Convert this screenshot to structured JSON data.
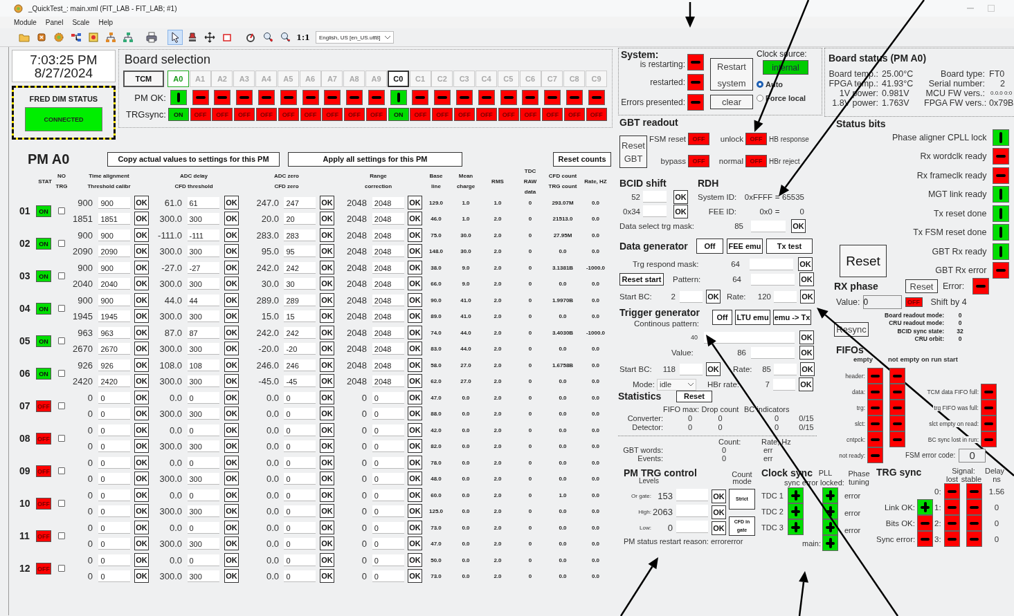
{
  "window": {
    "title": "_QuickTest_: main.xml (FIT_LAB - FIT_LAB; #1)"
  },
  "menu": [
    "Module",
    "Panel",
    "Scale",
    "Help"
  ],
  "toolbar": {
    "tools": [
      {
        "selected": false
      },
      {
        "selected": false
      },
      {
        "selected": false
      },
      {
        "selected": false
      },
      {
        "selected": false
      },
      {
        "selected": false
      },
      {
        "selected": false
      },
      {
        "selected": false
      },
      {
        "selected": true
      },
      {
        "selected": false
      },
      {
        "selected": false
      },
      {
        "selected": false
      },
      {
        "selected": false
      },
      {
        "selected": false
      },
      {
        "selected": false
      }
    ],
    "zoom_reset": "1:1",
    "language": "English, US [en_US.utf8]"
  },
  "clock": {
    "time": "7:03:25 PM",
    "date": "8/27/2024"
  },
  "fred": {
    "title": "FRED DIM STATUS",
    "status": "CONNECTED",
    "connected": true
  },
  "board_selection": {
    "title": "Board selection",
    "tcm": "TCM",
    "pm_ok_label": "PM OK:",
    "trgsync_label": "TRGsync:",
    "boards": [
      {
        "label": "A0",
        "selected": true,
        "disabled": false,
        "pm_ok": true,
        "trgsync": "ON",
        "trgsync_on": true
      },
      {
        "label": "A1",
        "selected": false,
        "disabled": true,
        "pm_ok": false,
        "trgsync": "OFF",
        "trgsync_on": false
      },
      {
        "label": "A2",
        "selected": false,
        "disabled": true,
        "pm_ok": false,
        "trgsync": "OFF",
        "trgsync_on": false
      },
      {
        "label": "A3",
        "selected": false,
        "disabled": true,
        "pm_ok": false,
        "trgsync": "OFF",
        "trgsync_on": false
      },
      {
        "label": "A4",
        "selected": false,
        "disabled": true,
        "pm_ok": false,
        "trgsync": "OFF",
        "trgsync_on": false
      },
      {
        "label": "A5",
        "selected": false,
        "disabled": true,
        "pm_ok": false,
        "trgsync": "OFF",
        "trgsync_on": false
      },
      {
        "label": "A6",
        "selected": false,
        "disabled": true,
        "pm_ok": false,
        "trgsync": "OFF",
        "trgsync_on": false
      },
      {
        "label": "A7",
        "selected": false,
        "disabled": true,
        "pm_ok": false,
        "trgsync": "OFF",
        "trgsync_on": false
      },
      {
        "label": "A8",
        "selected": false,
        "disabled": true,
        "pm_ok": false,
        "trgsync": "OFF",
        "trgsync_on": false
      },
      {
        "label": "A9",
        "selected": false,
        "disabled": true,
        "pm_ok": false,
        "trgsync": "OFF",
        "trgsync_on": false
      },
      {
        "label": "C0",
        "selected": false,
        "disabled": false,
        "pm_ok": true,
        "trgsync": "ON",
        "trgsync_on": true
      },
      {
        "label": "C1",
        "selected": false,
        "disabled": true,
        "pm_ok": false,
        "trgsync": "OFF",
        "trgsync_on": false
      },
      {
        "label": "C2",
        "selected": false,
        "disabled": true,
        "pm_ok": false,
        "trgsync": "OFF",
        "trgsync_on": false
      },
      {
        "label": "C3",
        "selected": false,
        "disabled": true,
        "pm_ok": false,
        "trgsync": "OFF",
        "trgsync_on": false
      },
      {
        "label": "C4",
        "selected": false,
        "disabled": true,
        "pm_ok": false,
        "trgsync": "OFF",
        "trgsync_on": false
      },
      {
        "label": "C5",
        "selected": false,
        "disabled": true,
        "pm_ok": false,
        "trgsync": "OFF",
        "trgsync_on": false
      },
      {
        "label": "C6",
        "selected": false,
        "disabled": true,
        "pm_ok": false,
        "trgsync": "OFF",
        "trgsync_on": false
      },
      {
        "label": "C7",
        "selected": false,
        "disabled": true,
        "pm_ok": false,
        "trgsync": "OFF",
        "trgsync_on": false
      },
      {
        "label": "C8",
        "selected": false,
        "disabled": true,
        "pm_ok": false,
        "trgsync": "OFF",
        "trgsync_on": false
      },
      {
        "label": "C9",
        "selected": false,
        "disabled": true,
        "pm_ok": false,
        "trgsync": "OFF",
        "trgsync_on": false
      }
    ]
  },
  "pm": {
    "title": "PM A0",
    "buttons": [
      "Copy actual values to settings for this PM",
      "Apply all settings for this PM",
      "Reset counts"
    ],
    "headers": [
      [
        "STAT"
      ],
      [
        "NO",
        "TRG"
      ],
      [
        "Time  alignment",
        "Threshold calibr"
      ],
      [
        "ADC delay",
        "CFD threshold"
      ],
      [
        "ADC zero",
        "CFD zero"
      ],
      [
        "Range",
        "correction"
      ],
      [
        "Base",
        "line"
      ],
      [
        "Mean",
        "charge"
      ],
      [
        "RMS"
      ],
      [
        "TDC",
        "RAW",
        "data"
      ],
      [
        "CFD count",
        "TRG count"
      ],
      [
        "Rate, HZ"
      ]
    ],
    "channels": [
      {
        "num": "01",
        "stat": "ON",
        "on": true,
        "no_trg": false,
        "settings": [
          [
            [
              "900",
              "900",
              "OK"
            ],
            [
              "1851",
              "1851",
              "OK"
            ]
          ],
          [
            [
              "61.0",
              "61",
              "OK"
            ],
            [
              "300.0",
              "300",
              "OK"
            ]
          ],
          [
            [
              "247.0",
              "247",
              "OK"
            ],
            [
              "20.0",
              "20",
              "OK"
            ]
          ],
          [
            [
              "2048",
              "2048",
              "OK"
            ],
            [
              "2048",
              "2048",
              "OK"
            ]
          ]
        ],
        "readings": [
          [
            "129.0",
            "46.0"
          ],
          [
            "1.0",
            "1.0"
          ],
          [
            "1.0",
            "2.0"
          ],
          [
            "0",
            "0"
          ],
          [
            "293.07M",
            "21513.0"
          ],
          [
            "0.0",
            "0.0"
          ]
        ]
      },
      {
        "num": "02",
        "stat": "ON",
        "on": true,
        "no_trg": false,
        "settings": [
          [
            [
              "900",
              "900",
              "OK"
            ],
            [
              "2090",
              "2090",
              "OK"
            ]
          ],
          [
            [
              "-111.0",
              "-111",
              "OK"
            ],
            [
              "300.0",
              "300",
              "OK"
            ]
          ],
          [
            [
              "283.0",
              "283",
              "OK"
            ],
            [
              "95.0",
              "95",
              "OK"
            ]
          ],
          [
            [
              "2048",
              "2048",
              "OK"
            ],
            [
              "2048",
              "2048",
              "OK"
            ]
          ]
        ],
        "readings": [
          [
            "75.0",
            "148.0"
          ],
          [
            "30.0",
            "30.0"
          ],
          [
            "2.0",
            "2.0"
          ],
          [
            "0",
            "0"
          ],
          [
            "27.95M",
            "0.0"
          ],
          [
            "0.0",
            "0.0"
          ]
        ]
      },
      {
        "num": "03",
        "stat": "ON",
        "on": true,
        "no_trg": false,
        "settings": [
          [
            [
              "900",
              "900",
              "OK"
            ],
            [
              "2040",
              "2040",
              "OK"
            ]
          ],
          [
            [
              "-27.0",
              "-27",
              "OK"
            ],
            [
              "300.0",
              "300",
              "OK"
            ]
          ],
          [
            [
              "242.0",
              "242",
              "OK"
            ],
            [
              "30.0",
              "30",
              "OK"
            ]
          ],
          [
            [
              "2048",
              "2048",
              "OK"
            ],
            [
              "2048",
              "2048",
              "OK"
            ]
          ]
        ],
        "readings": [
          [
            "38.0",
            "66.0"
          ],
          [
            "9.0",
            "9.0"
          ],
          [
            "2.0",
            "2.0"
          ],
          [
            "0",
            "0"
          ],
          [
            "3.1381B",
            "0.0"
          ],
          [
            "-1000.0",
            "0.0"
          ]
        ]
      },
      {
        "num": "04",
        "stat": "ON",
        "on": true,
        "no_trg": false,
        "settings": [
          [
            [
              "900",
              "900",
              "OK"
            ],
            [
              "1945",
              "1945",
              "OK"
            ]
          ],
          [
            [
              "44.0",
              "44",
              "OK"
            ],
            [
              "300.0",
              "300",
              "OK"
            ]
          ],
          [
            [
              "289.0",
              "289",
              "OK"
            ],
            [
              "15.0",
              "15",
              "OK"
            ]
          ],
          [
            [
              "2048",
              "2048",
              "OK"
            ],
            [
              "2048",
              "2048",
              "OK"
            ]
          ]
        ],
        "readings": [
          [
            "90.0",
            "89.0"
          ],
          [
            "41.0",
            "41.0"
          ],
          [
            "2.0",
            "2.0"
          ],
          [
            "0",
            "0"
          ],
          [
            "1.9970B",
            "0.0"
          ],
          [
            "0.0",
            "0.0"
          ]
        ]
      },
      {
        "num": "05",
        "stat": "ON",
        "on": true,
        "no_trg": false,
        "settings": [
          [
            [
              "963",
              "963",
              "OK"
            ],
            [
              "2670",
              "2670",
              "OK"
            ]
          ],
          [
            [
              "87.0",
              "87",
              "OK"
            ],
            [
              "300.0",
              "300",
              "OK"
            ]
          ],
          [
            [
              "242.0",
              "242",
              "OK"
            ],
            [
              "-20.0",
              "-20",
              "OK"
            ]
          ],
          [
            [
              "2048",
              "2048",
              "OK"
            ],
            [
              "2048",
              "2048",
              "OK"
            ]
          ]
        ],
        "readings": [
          [
            "74.0",
            "83.0"
          ],
          [
            "44.0",
            "44.0"
          ],
          [
            "2.0",
            "2.0"
          ],
          [
            "0",
            "0"
          ],
          [
            "3.4030B",
            "0.0"
          ],
          [
            "-1000.0",
            "0.0"
          ]
        ]
      },
      {
        "num": "06",
        "stat": "ON",
        "on": true,
        "no_trg": false,
        "settings": [
          [
            [
              "926",
              "926",
              "OK"
            ],
            [
              "2420",
              "2420",
              "OK"
            ]
          ],
          [
            [
              "108.0",
              "108",
              "OK"
            ],
            [
              "300.0",
              "300",
              "OK"
            ]
          ],
          [
            [
              "246.0",
              "246",
              "OK"
            ],
            [
              "-45.0",
              "-45",
              "OK"
            ]
          ],
          [
            [
              "2048",
              "2048",
              "OK"
            ],
            [
              "2048",
              "2048",
              "OK"
            ]
          ]
        ],
        "readings": [
          [
            "58.0",
            "62.0"
          ],
          [
            "27.0",
            "27.0"
          ],
          [
            "2.0",
            "2.0"
          ],
          [
            "0",
            "0"
          ],
          [
            "1.6758B",
            "0.0"
          ],
          [
            "0.0",
            "0.0"
          ]
        ]
      },
      {
        "num": "07",
        "stat": "OFF",
        "on": false,
        "no_trg": false,
        "settings": [
          [
            [
              "0",
              "0",
              "OK"
            ],
            [
              "0",
              "0",
              "OK"
            ]
          ],
          [
            [
              "0.0",
              "0",
              "OK"
            ],
            [
              "300.0",
              "300",
              "OK"
            ]
          ],
          [
            [
              "0.0",
              "0",
              "OK"
            ],
            [
              "0.0",
              "0",
              "OK"
            ]
          ],
          [
            [
              "0",
              "0",
              "OK"
            ],
            [
              "0",
              "0",
              "OK"
            ]
          ]
        ],
        "readings": [
          [
            "47.0",
            "88.0"
          ],
          [
            "0.0",
            "0.0"
          ],
          [
            "2.0",
            "2.0"
          ],
          [
            "0",
            "0"
          ],
          [
            "0.0",
            "0.0"
          ],
          [
            "0.0",
            "0.0"
          ]
        ]
      },
      {
        "num": "08",
        "stat": "OFF",
        "on": false,
        "no_trg": false,
        "settings": [
          [
            [
              "0",
              "0",
              "OK"
            ],
            [
              "0",
              "0",
              "OK"
            ]
          ],
          [
            [
              "0.0",
              "0",
              "OK"
            ],
            [
              "300.0",
              "300",
              "OK"
            ]
          ],
          [
            [
              "0.0",
              "0",
              "OK"
            ],
            [
              "0.0",
              "0",
              "OK"
            ]
          ],
          [
            [
              "0",
              "0",
              "OK"
            ],
            [
              "0",
              "0",
              "OK"
            ]
          ]
        ],
        "readings": [
          [
            "42.0",
            "82.0"
          ],
          [
            "0.0",
            "0.0"
          ],
          [
            "2.0",
            "2.0"
          ],
          [
            "0",
            "0"
          ],
          [
            "0.0",
            "0.0"
          ],
          [
            "0.0",
            "0.0"
          ]
        ]
      },
      {
        "num": "09",
        "stat": "OFF",
        "on": false,
        "no_trg": false,
        "settings": [
          [
            [
              "0",
              "0",
              "OK"
            ],
            [
              "0",
              "0",
              "OK"
            ]
          ],
          [
            [
              "0.0",
              "0",
              "OK"
            ],
            [
              "300.0",
              "300",
              "OK"
            ]
          ],
          [
            [
              "0.0",
              "0",
              "OK"
            ],
            [
              "0.0",
              "0",
              "OK"
            ]
          ],
          [
            [
              "0",
              "0",
              "OK"
            ],
            [
              "0",
              "0",
              "OK"
            ]
          ]
        ],
        "readings": [
          [
            "78.0",
            "48.0"
          ],
          [
            "0.0",
            "0.0"
          ],
          [
            "2.0",
            "2.0"
          ],
          [
            "0",
            "0"
          ],
          [
            "0.0",
            "0.0"
          ],
          [
            "0.0",
            "0.0"
          ]
        ]
      },
      {
        "num": "10",
        "stat": "OFF",
        "on": false,
        "no_trg": false,
        "settings": [
          [
            [
              "0",
              "0",
              "OK"
            ],
            [
              "0",
              "0",
              "OK"
            ]
          ],
          [
            [
              "0.0",
              "0",
              "OK"
            ],
            [
              "300.0",
              "300",
              "OK"
            ]
          ],
          [
            [
              "0.0",
              "0",
              "OK"
            ],
            [
              "0.0",
              "0",
              "OK"
            ]
          ],
          [
            [
              "0",
              "0",
              "OK"
            ],
            [
              "0",
              "0",
              "OK"
            ]
          ]
        ],
        "readings": [
          [
            "60.0",
            "125.0"
          ],
          [
            "0.0",
            "0.0"
          ],
          [
            "2.0",
            "2.0"
          ],
          [
            "0",
            "0"
          ],
          [
            "1.0",
            "0.0"
          ],
          [
            "0.0",
            "0.0"
          ]
        ]
      },
      {
        "num": "11",
        "stat": "OFF",
        "on": false,
        "no_trg": false,
        "settings": [
          [
            [
              "0",
              "0",
              "OK"
            ],
            [
              "0",
              "0",
              "OK"
            ]
          ],
          [
            [
              "0.0",
              "0",
              "OK"
            ],
            [
              "300.0",
              "300",
              "OK"
            ]
          ],
          [
            [
              "0.0",
              "0",
              "OK"
            ],
            [
              "0.0",
              "0",
              "OK"
            ]
          ],
          [
            [
              "0",
              "0",
              "OK"
            ],
            [
              "0",
              "0",
              "OK"
            ]
          ]
        ],
        "readings": [
          [
            "73.0",
            "47.0"
          ],
          [
            "0.0",
            "0.0"
          ],
          [
            "2.0",
            "2.0"
          ],
          [
            "0",
            "0"
          ],
          [
            "0.0",
            "0.0"
          ],
          [
            "0.0",
            "0.0"
          ]
        ]
      },
      {
        "num": "12",
        "stat": "OFF",
        "on": false,
        "no_trg": false,
        "settings": [
          [
            [
              "0",
              "0",
              "OK"
            ],
            [
              "0",
              "0",
              "OK"
            ]
          ],
          [
            [
              "0.0",
              "0",
              "OK"
            ],
            [
              "300.0",
              "300",
              "OK"
            ]
          ],
          [
            [
              "0.0",
              "0",
              "OK"
            ],
            [
              "0.0",
              "0",
              "OK"
            ]
          ],
          [
            [
              "0",
              "0",
              "OK"
            ],
            [
              "0",
              "0",
              "OK"
            ]
          ]
        ],
        "readings": [
          [
            "50.0",
            "73.0"
          ],
          [
            "0.0",
            "0.0"
          ],
          [
            "2.0",
            "2.0"
          ],
          [
            "0",
            "0"
          ],
          [
            "0.0",
            "0.0"
          ],
          [
            "0.0",
            "0.0"
          ]
        ]
      }
    ]
  },
  "system": {
    "title": "System:",
    "indicators": [
      {
        "label": "is restarting:",
        "on": false
      },
      {
        "label": "restarted:",
        "on": false
      },
      {
        "label": "Errors presented:",
        "on": false
      }
    ],
    "restart_button": "Restart system",
    "clear_button": "clear",
    "clock_source": {
      "label": "Clock source:",
      "value": "internal",
      "ok": true,
      "options": [
        {
          "label": "Auto",
          "selected": true
        },
        {
          "label": "Force local",
          "selected": false
        }
      ]
    }
  },
  "gbt_readout": {
    "title": "GBT readout",
    "reset_button": "Reset GBT",
    "rows": [
      [
        {
          "label": "FSM reset",
          "value": "OFF",
          "on": false
        },
        {
          "label": "unlock",
          "value": "OFF",
          "on": false,
          "note": "HB response"
        }
      ],
      [
        {
          "label": "bypass",
          "value": "OFF",
          "on": false
        },
        {
          "label": "normal",
          "value": "OFF",
          "on": false,
          "note": "HBr reject"
        }
      ]
    ]
  },
  "bcid_shift": {
    "title": "BCID shift",
    "rows": [
      {
        "value": "52",
        "button": "OK"
      },
      {
        "value": "0x34",
        "button": "OK"
      }
    ]
  },
  "rdh": {
    "title": "RDH",
    "rows": [
      {
        "label": "System ID:",
        "hex": "0xFFFF",
        "eq": "=",
        "dec": "65535"
      },
      {
        "label": "FEE ID:",
        "hex": "0x0",
        "eq": "=",
        "dec": "0"
      }
    ],
    "mask": {
      "label": "Data select trg mask:",
      "value": "85",
      "button": "OK"
    }
  },
  "data_generator": {
    "title": "Data generator",
    "modes": [
      "Off",
      "FEE emu",
      "Tx test"
    ],
    "trg_respond": {
      "label": "Trg respond mask:",
      "value": "64",
      "button": "OK"
    },
    "reset_start": "Reset start",
    "pattern": {
      "label": "Pattern:",
      "value": "64",
      "button": "OK"
    },
    "start_bc": {
      "label": "Start BC:",
      "value": "2",
      "button": "OK"
    },
    "rate": {
      "label": "Rate:",
      "value": "120",
      "button": "OK"
    }
  },
  "trigger_generator": {
    "title": "Trigger generator",
    "modes": [
      "Off",
      "LTU emu",
      "emu -> Tx"
    ],
    "pattern_label": "Continous pattern:",
    "pattern": {
      "value": "40",
      "button": "OK"
    },
    "value": {
      "label": "Value:",
      "value": "86",
      "button": "OK"
    },
    "start_bc": {
      "label": "Start BC:",
      "value": "118",
      "button": "OK"
    },
    "rate": {
      "label": "Rate:",
      "value": "85",
      "button": "OK"
    },
    "mode": {
      "label": "Mode:",
      "value": "idle"
    },
    "hbr_rate": {
      "label": "HBr rate:",
      "value": "7",
      "button": "OK"
    }
  },
  "statistics": {
    "title": "Statistics",
    "reset": "Reset",
    "headers": [
      "FIFO max:",
      "Drop count",
      "BC indicators"
    ],
    "rows": [
      {
        "label": "Converter:",
        "values": [
          "0",
          "0",
          "0",
          "0/15"
        ]
      },
      {
        "label": "Detector:",
        "values": [
          "0",
          "0",
          "0",
          "0/15"
        ]
      }
    ],
    "count_headers": [
      "Count:",
      "Rate, Hz"
    ],
    "count_rows": [
      {
        "label": "GBT words:",
        "values": [
          "0",
          "err"
        ]
      },
      {
        "label": "Events:",
        "values": [
          "0",
          "err"
        ]
      }
    ]
  },
  "pm_trg_control": {
    "title": "PM TRG control",
    "levels_label": "Levels",
    "count_mode_label": "Count mode",
    "levels": [
      {
        "label": "Or gate:",
        "value": "153",
        "button": "OK"
      },
      {
        "label": "High:",
        "value": "2063",
        "button": "OK"
      },
      {
        "label": "Low:",
        "value": "0",
        "button": "OK"
      }
    ],
    "mode_buttons": [
      "Strict",
      "CFD in gate"
    ],
    "restart_reason": "PM status restart reason: errorerror"
  },
  "clock_sync": {
    "title": "Clock sync",
    "sync_error_label": "sync error",
    "tdcs": [
      {
        "label": "TDC 1",
        "ok": true
      },
      {
        "label": "TDC 2",
        "ok": true
      },
      {
        "label": "TDC 3",
        "ok": true
      }
    ],
    "pll_label": "PLL",
    "locked_label": "locked:",
    "pll": [
      {
        "ok": true
      },
      {
        "ok": true
      },
      {
        "ok": true
      },
      {
        "label": "main:",
        "ok": true
      }
    ],
    "phase_label": "Phase tuning",
    "phase": [
      "error",
      "error",
      "error"
    ]
  },
  "board_status": {
    "title": "Board status (PM A0)",
    "left": [
      {
        "label": "Board temp.:",
        "value": "25.00°C"
      },
      {
        "label": "FPGA temp.:",
        "value": "41.93°C"
      },
      {
        "label": "1V power:",
        "value": "0.981V"
      },
      {
        "label": "1.8V power:",
        "value": "1.763V"
      }
    ],
    "right": [
      {
        "label": "Board type:",
        "value": "FT0"
      },
      {
        "label": "Serial number:",
        "value": "2"
      },
      {
        "label": "MCU FW vers.:",
        "value": "0.0.0 0:0"
      },
      {
        "label": "FPGA FW vers.:",
        "value": "0x79B"
      }
    ]
  },
  "status_bits": {
    "title": "Status bits",
    "bits": [
      {
        "label": "Phase aligner CPLL lock",
        "ok": true
      },
      {
        "label": "Rx wordclk ready",
        "ok": false
      },
      {
        "label": "Rx frameclk ready",
        "ok": false
      },
      {
        "label": "MGT link ready",
        "ok": true
      },
      {
        "label": "Tx reset done",
        "ok": true
      },
      {
        "label": "Tx FSM reset done",
        "ok": true
      },
      {
        "label": "GBT Rx ready",
        "ok": true
      },
      {
        "label": "GBT Rx error",
        "ok": false
      }
    ],
    "reset_button": "Reset"
  },
  "rx_phase": {
    "title": "RX phase",
    "reset": "Reset",
    "error_label": "Error:",
    "error": false,
    "value_label": "Value:",
    "value": "0",
    "shift": {
      "value": "OFF",
      "on": false,
      "label": "Shift by 4"
    }
  },
  "readout": {
    "rows": [
      {
        "label": "Board readout mode:",
        "value": "0"
      },
      {
        "label": "CRU readout mode:",
        "value": "0"
      },
      {
        "label": "BCID sync state:",
        "value": "32"
      },
      {
        "label": "CRU orbit:",
        "value": "0"
      }
    ],
    "resync": "Resync"
  },
  "fifos": {
    "title": "FIFOs",
    "empty_label": "empty",
    "not_empty_label": "not empty on run start",
    "rows": [
      {
        "label": "header:",
        "empty": false,
        "not_empty": false
      },
      {
        "label": "data:",
        "empty": false,
        "not_empty": false
      },
      {
        "label": "trg:",
        "empty": false,
        "not_empty": false
      },
      {
        "label": "slct:",
        "empty": false,
        "not_empty": false
      },
      {
        "label": "cntpck:",
        "empty": false,
        "not_empty": false
      },
      {
        "label": "not ready:",
        "empty": false
      }
    ],
    "flags": [
      {
        "label": "TCM data FIFO full:",
        "on": false
      },
      {
        "label": "trg FIFO was full:",
        "on": false
      },
      {
        "label": "slct empty on read:",
        "on": false
      },
      {
        "label": "BC sync lost in run:",
        "on": false
      }
    ],
    "fsm": {
      "label": "FSM error code:",
      "value": "0"
    }
  },
  "trg_sync": {
    "title": "TRG sync",
    "signal_label": "Signal:",
    "lost_label": "lost",
    "stable_label": "stable",
    "delay_label": "Delay",
    "delay_unit": "ns",
    "channels": [
      {
        "label": "0:",
        "lost": false,
        "stable": false,
        "delay": "1.56"
      },
      {
        "label": "1:",
        "lost": false,
        "stable": false,
        "delay": "0"
      },
      {
        "label": "2:",
        "lost": false,
        "stable": false,
        "delay": "0"
      },
      {
        "label": "3:",
        "lost": false,
        "stable": false,
        "delay": "0"
      }
    ],
    "link": [
      {
        "label": "Link OK:",
        "ok": true
      },
      {
        "label": "Bits OK:",
        "ok": false
      },
      {
        "label": "Sync error:",
        "ok": false
      }
    ]
  }
}
